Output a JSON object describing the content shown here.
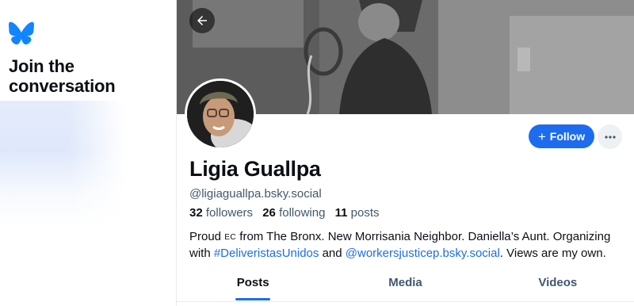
{
  "sidebar": {
    "logo_icon": "butterfly-icon",
    "brand_color": "#1185fe",
    "join_title": "Join the conversation"
  },
  "profile": {
    "name": "Ligia Guallpa",
    "handle": "@ligiaguallpa.bsky.social",
    "stats": {
      "followers_count": "32",
      "followers_label": "followers",
      "following_count": "26",
      "following_label": "following",
      "posts_count": "11",
      "posts_label": "posts"
    },
    "bio": {
      "part1": "Proud ",
      "flag": "EC",
      "part2": " from The Bronx. New Morrisania Neighbor. Daniella’s Aunt. Organizing with ",
      "hashtag": "#DeliveristasUnidos",
      "part3": " and ",
      "mention": "@workersjusticep.bsky.social",
      "part4": ". Views are my own."
    }
  },
  "actions": {
    "back_icon": "arrow-left-icon",
    "follow_label": "Follow",
    "follow_icon": "plus-icon",
    "more_icon": "ellipsis-icon"
  },
  "tabs": [
    {
      "label": "Posts",
      "active": true
    },
    {
      "label": "Media",
      "active": false
    },
    {
      "label": "Videos",
      "active": false
    }
  ],
  "colors": {
    "accent": "#1d6cf0",
    "muted_text": "#42576c"
  }
}
